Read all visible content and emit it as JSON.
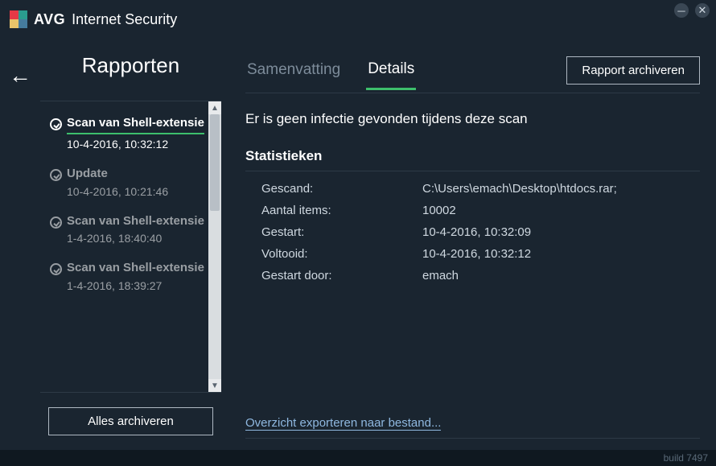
{
  "window": {
    "brand": "AVG",
    "product": "Internet Security",
    "build_label": "build 7497"
  },
  "sidebar": {
    "title": "Rapporten",
    "archive_all_label": "Alles archiveren",
    "items": [
      {
        "title": "Scan van Shell-extensie",
        "date": "10-4-2016, 10:32:12",
        "active": true
      },
      {
        "title": "Update",
        "date": "10-4-2016, 10:21:46",
        "active": false
      },
      {
        "title": "Scan van Shell-extensie",
        "date": "1-4-2016, 18:40:40",
        "active": false
      },
      {
        "title": "Scan van Shell-extensie",
        "date": "1-4-2016, 18:39:27",
        "active": false
      }
    ]
  },
  "main": {
    "tabs": {
      "summary": "Samenvatting",
      "details": "Details"
    },
    "archive_report_label": "Rapport archiveren",
    "message": "Er is geen infectie gevonden tijdens deze scan",
    "stats_heading": "Statistieken",
    "stats": [
      {
        "label": "Gescand:",
        "value": "C:\\Users\\emach\\Desktop\\htdocs.rar;"
      },
      {
        "label": "Aantal items:",
        "value": "10002"
      },
      {
        "label": "Gestart:",
        "value": "10-4-2016, 10:32:09"
      },
      {
        "label": "Voltooid:",
        "value": "10-4-2016, 10:32:12"
      },
      {
        "label": "Gestart door:",
        "value": "emach"
      }
    ],
    "export_link": "Overzicht exporteren naar bestand..."
  }
}
